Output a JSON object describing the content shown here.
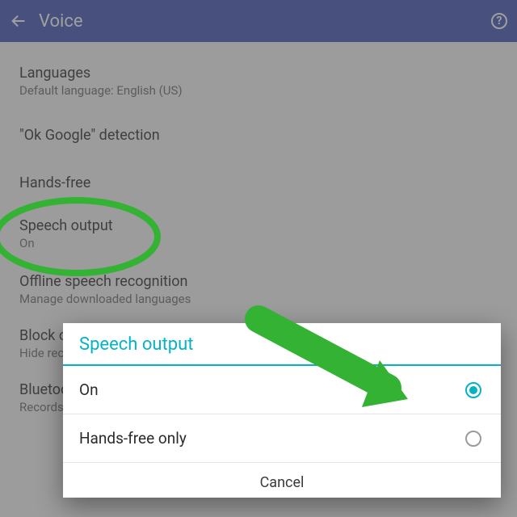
{
  "appbar": {
    "title": "Voice",
    "help_glyph": "?"
  },
  "settings": {
    "languages": {
      "title": "Languages",
      "sub": "Default language: English (US)"
    },
    "okgoogle": {
      "title": "\"Ok Google\" detection"
    },
    "handsfree": {
      "title": "Hands-free"
    },
    "speechoutput": {
      "title": "Speech output",
      "sub": "On"
    },
    "offline": {
      "title": "Offline speech recognition",
      "sub": "Manage downloaded languages"
    },
    "block": {
      "title": "Block offensive words",
      "sub": "Hide recognized offensive voice results",
      "switch": "ON"
    },
    "bluetooth": {
      "title": "Bluetooth headset",
      "sub": "Records audio through Bluetooth headset if available",
      "switch": "ON"
    }
  },
  "dialog": {
    "title": "Speech output",
    "options": [
      {
        "label": "On",
        "checked": true
      },
      {
        "label": "Hands-free only",
        "checked": false
      }
    ],
    "cancel": "Cancel"
  },
  "colors": {
    "accent": "#05b3c4",
    "appbar": "#3f51b5",
    "annotation": "#34b233"
  }
}
